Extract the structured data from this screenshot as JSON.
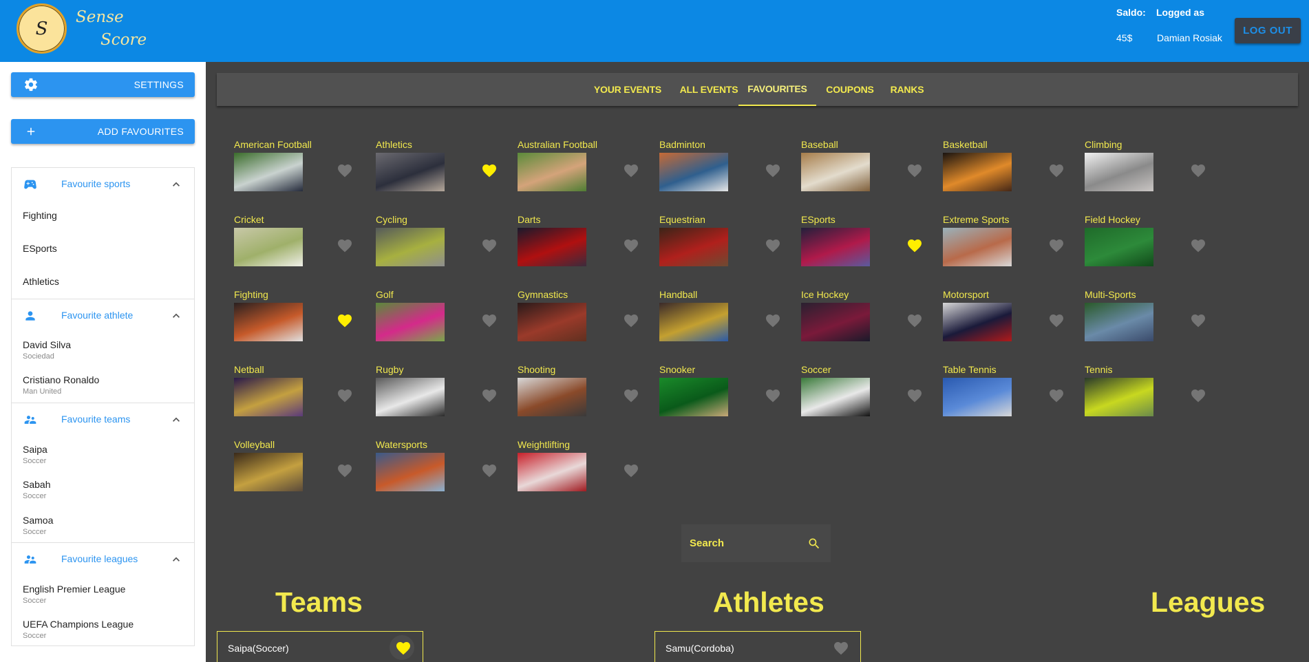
{
  "header": {
    "brand_line1": "Sense",
    "brand_line2": "Score",
    "logo_letter": "S",
    "saldo_label": "Saldo:",
    "saldo_value": "45$",
    "logged_label": "Logged as",
    "logged_value": "Damian Rosiak",
    "logout_label": "LOG OUT"
  },
  "sidebar": {
    "settings_label": "SETTINGS",
    "add_label": "ADD FAVOURITES",
    "sections": [
      {
        "title": "Favourite sports",
        "icon": "gamepad-icon",
        "items": [
          {
            "name": "Fighting"
          },
          {
            "name": "ESports"
          },
          {
            "name": "Athletics"
          }
        ]
      },
      {
        "title": "Favourite athlete",
        "icon": "person-icon",
        "items": [
          {
            "name": "David Silva",
            "sub": "Sociedad"
          },
          {
            "name": "Cristiano Ronaldo",
            "sub": "Man United"
          }
        ]
      },
      {
        "title": "Favourite teams",
        "icon": "group-icon",
        "items": [
          {
            "name": "Saipa",
            "sub": "Soccer"
          },
          {
            "name": "Sabah",
            "sub": "Soccer"
          },
          {
            "name": "Samoa",
            "sub": "Soccer"
          }
        ]
      },
      {
        "title": "Favourite leagues",
        "icon": "group-icon",
        "items": [
          {
            "name": "English Premier League",
            "sub": "Soccer"
          },
          {
            "name": "UEFA Champions League",
            "sub": "Soccer"
          }
        ]
      }
    ]
  },
  "tabs": [
    {
      "label": "YOUR EVENTS",
      "active": false
    },
    {
      "label": "ALL EVENTS",
      "active": false
    },
    {
      "label": "FAVOURITES",
      "active": true
    },
    {
      "label": "COUPONS",
      "active": false
    },
    {
      "label": "RANKS",
      "active": false
    }
  ],
  "sports": [
    {
      "name": "American Football",
      "fav": false
    },
    {
      "name": "Athletics",
      "fav": true
    },
    {
      "name": "Australian Football",
      "fav": false
    },
    {
      "name": "Badminton",
      "fav": false
    },
    {
      "name": "Baseball",
      "fav": false
    },
    {
      "name": "Basketball",
      "fav": false
    },
    {
      "name": "Climbing",
      "fav": false
    },
    {
      "name": "Cricket",
      "fav": false
    },
    {
      "name": "Cycling",
      "fav": false
    },
    {
      "name": "Darts",
      "fav": false
    },
    {
      "name": "Equestrian",
      "fav": false
    },
    {
      "name": "ESports",
      "fav": true
    },
    {
      "name": "Extreme Sports",
      "fav": false
    },
    {
      "name": "Field Hockey",
      "fav": false
    },
    {
      "name": "Fighting",
      "fav": true
    },
    {
      "name": "Golf",
      "fav": false
    },
    {
      "name": "Gymnastics",
      "fav": false
    },
    {
      "name": "Handball",
      "fav": false
    },
    {
      "name": "Ice Hockey",
      "fav": false
    },
    {
      "name": "Motorsport",
      "fav": false
    },
    {
      "name": "Multi-Sports",
      "fav": false
    },
    {
      "name": "Netball",
      "fav": false
    },
    {
      "name": "Rugby",
      "fav": false
    },
    {
      "name": "Shooting",
      "fav": false
    },
    {
      "name": "Snooker",
      "fav": false
    },
    {
      "name": "Soccer",
      "fav": false
    },
    {
      "name": "Table Tennis",
      "fav": false
    },
    {
      "name": "Tennis",
      "fav": false
    },
    {
      "name": "Volleyball",
      "fav": false
    },
    {
      "name": "Watersports",
      "fav": false
    },
    {
      "name": "Weightlifting",
      "fav": false
    }
  ],
  "search": {
    "placeholder": "Search"
  },
  "columns": {
    "teams": "Teams",
    "athletes": "Athletes",
    "leagues": "Leagues"
  },
  "results": {
    "team": {
      "label": "Saipa(Soccer)",
      "fav": true
    },
    "athlete": {
      "label": "Samu(Cordoba)",
      "fav": false
    }
  },
  "colors": {
    "header": "#0c88e4",
    "accent": "#f2e94e",
    "heart_on": "#ffee00",
    "heart_off": "#757575",
    "main_bg": "#424242"
  }
}
